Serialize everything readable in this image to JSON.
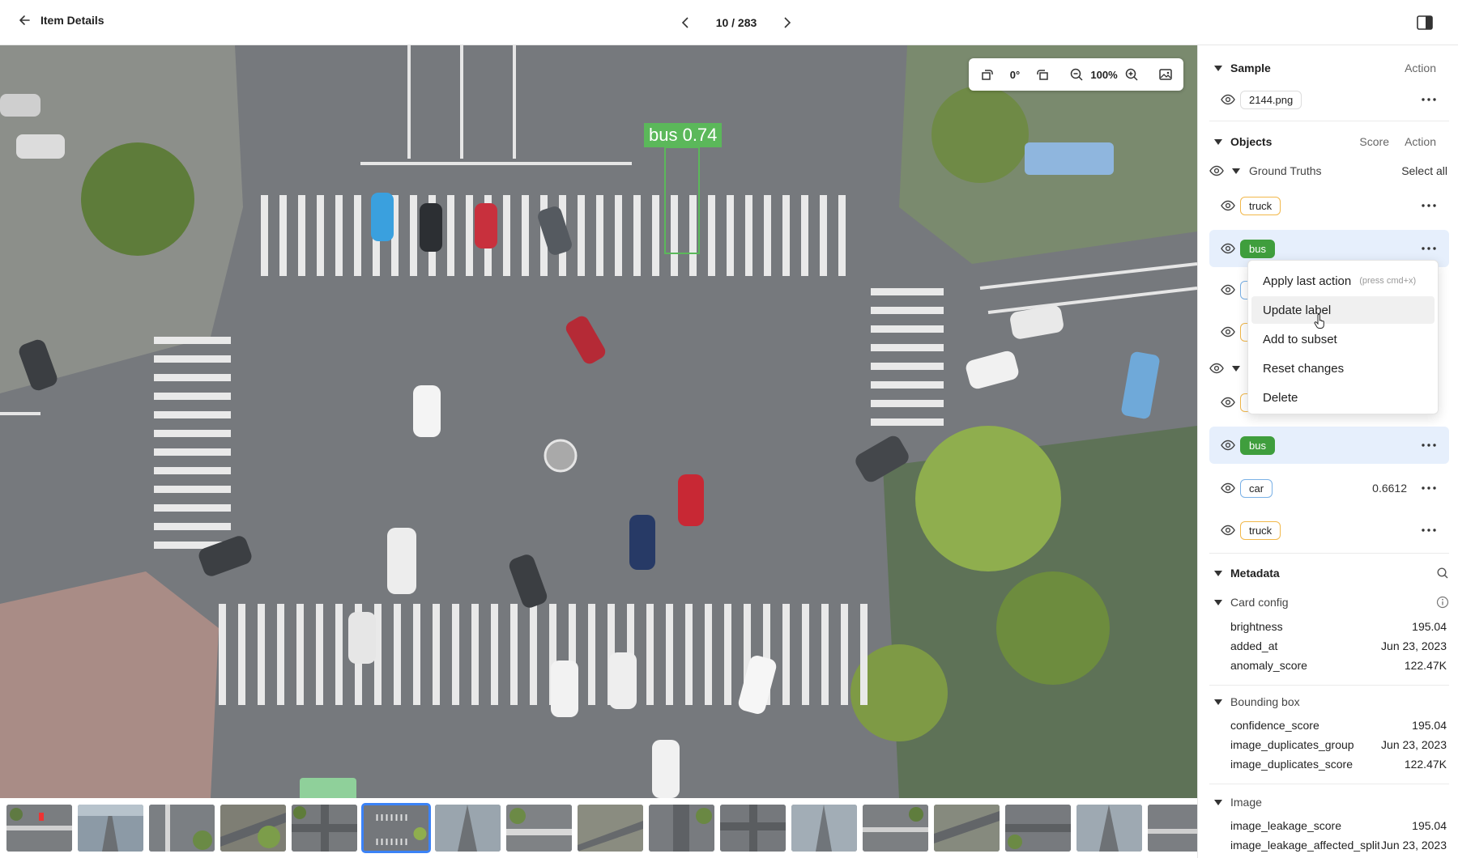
{
  "header": {
    "back_label": "Item Details",
    "pager": "10 / 283"
  },
  "toolbar": {
    "rotation": "0°",
    "zoom": "100%"
  },
  "detection": {
    "label": "bus 0.74",
    "color": "#5bb85a"
  },
  "sample": {
    "title": "Sample",
    "action_label": "Action",
    "file": "2144.png"
  },
  "objects": {
    "title": "Objects",
    "score_label": "Score",
    "action_label": "Action",
    "ground_truths_label": "Ground Truths",
    "select_all_label": "Select all",
    "gt_items": [
      {
        "label": "truck",
        "color": "#f2b84b"
      },
      {
        "label": "bus",
        "color": "#3f9e3d"
      }
    ],
    "pred_items": [
      {
        "label": "bus",
        "color": "#3f9e3d"
      },
      {
        "label": "car",
        "color": "#7ab1e6",
        "score": "0.6612"
      },
      {
        "label": "truck",
        "color": "#f2b84b"
      }
    ]
  },
  "context_menu": {
    "items": [
      {
        "label": "Apply last action",
        "hint": "(press cmd+x)"
      },
      {
        "label": "Update label"
      },
      {
        "label": "Add to subset"
      },
      {
        "label": "Reset changes"
      },
      {
        "label": "Delete"
      }
    ]
  },
  "metadata": {
    "title": "Metadata",
    "groups": [
      {
        "title": "Card config",
        "rows": [
          {
            "key": "brightness",
            "value": "195.04"
          },
          {
            "key": "added_at",
            "value": "Jun 23, 2023"
          },
          {
            "key": "anomaly_score",
            "value": "122.47K"
          }
        ]
      },
      {
        "title": "Bounding box",
        "rows": [
          {
            "key": "confidence_score",
            "value": "195.04"
          },
          {
            "key": "image_duplicates_group",
            "value": "Jun 23, 2023"
          },
          {
            "key": "image_duplicates_score",
            "value": "122.47K"
          }
        ]
      },
      {
        "title": "Image",
        "rows": [
          {
            "key": "image_leakage_score",
            "value": "195.04"
          },
          {
            "key": "image_leakage_affected_splits",
            "value": "Jun 23, 2023"
          }
        ]
      }
    ]
  },
  "filmstrip": {
    "count": 17,
    "active_index": 5,
    "accent": "#3b82f6"
  }
}
